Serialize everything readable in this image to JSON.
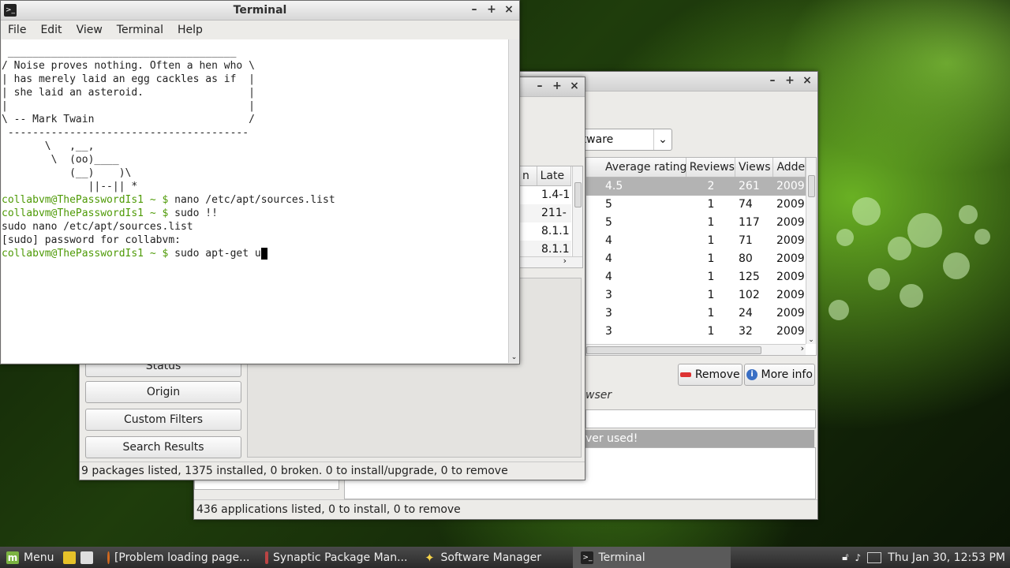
{
  "terminal": {
    "title": "Terminal",
    "menu": [
      "File",
      "Edit",
      "View",
      "Terminal",
      "Help"
    ],
    "lines": [
      {
        "text": " _____________________________________",
        "type": "plain"
      },
      {
        "text": "/ Noise proves nothing. Often a hen who \\",
        "type": "plain"
      },
      {
        "text": "| has merely laid an egg cackles as if  |",
        "type": "plain"
      },
      {
        "text": "| she laid an asteroid.                 |",
        "type": "plain"
      },
      {
        "text": "|                                       |",
        "type": "plain"
      },
      {
        "text": "\\ -- Mark Twain                         /",
        "type": "plain"
      },
      {
        "text": " ---------------------------------------",
        "type": "plain"
      },
      {
        "text": "       \\   ,__,",
        "type": "plain"
      },
      {
        "text": "        \\  (oo)____",
        "type": "plain"
      },
      {
        "text": "           (__)    )\\",
        "type": "plain"
      },
      {
        "text": "              ||--|| *",
        "type": "plain"
      },
      {
        "prompt": "collabvm@ThePasswordIs1 ~ $",
        "cmd": " nano /etc/apt/sources.list",
        "type": "prompt"
      },
      {
        "prompt": "collabvm@ThePasswordIs1 ~ $",
        "cmd": " sudo !!",
        "type": "prompt"
      },
      {
        "text": "sudo nano /etc/apt/sources.list",
        "type": "plain"
      },
      {
        "text": "[sudo] password for collabvm:",
        "type": "plain"
      },
      {
        "prompt": "collabvm@ThePasswordIs1 ~ $",
        "cmd": " sudo apt-get u",
        "type": "prompt",
        "cursor": true
      }
    ]
  },
  "synaptic": {
    "columns": [
      "n",
      "Late"
    ],
    "versions": [
      "1.4-1",
      "211-",
      "8.1.1",
      "8.1.1"
    ],
    "side_buttons": [
      "Status",
      "Origin",
      "Custom Filters",
      "Search Results"
    ],
    "status": "9 packages listed, 1375 installed, 0 broken. 0 to install/upgrade, 0 to remove"
  },
  "software_manager": {
    "filter_value": "ftware",
    "columns": [
      "Average rating",
      "Reviews",
      "Views",
      "Adde"
    ],
    "rows": [
      {
        "rating": "4.5",
        "reviews": "2",
        "views": "261",
        "added": "2009-"
      },
      {
        "rating": "5",
        "reviews": "1",
        "views": "74",
        "added": "2009-"
      },
      {
        "rating": "5",
        "reviews": "1",
        "views": "117",
        "added": "2009-"
      },
      {
        "rating": "4",
        "reviews": "1",
        "views": "71",
        "added": "2009-"
      },
      {
        "rating": "4",
        "reviews": "1",
        "views": "80",
        "added": "2009-"
      },
      {
        "rating": "4",
        "reviews": "1",
        "views": "125",
        "added": "2009-"
      },
      {
        "rating": "3",
        "reviews": "1",
        "views": "102",
        "added": "2009-"
      },
      {
        "rating": "3",
        "reviews": "1",
        "views": "24",
        "added": "2009-"
      },
      {
        "rating": "3",
        "reviews": "1",
        "views": "32",
        "added": "2009-"
      }
    ],
    "remove_label": "Remove",
    "more_info_label": "More info",
    "browser_label": "wser",
    "never_used": "ver used!",
    "status": "436 applications listed, 0 to install, 0 to remove"
  },
  "taskbar": {
    "menu_label": "Menu",
    "tasks": [
      {
        "label": "[Problem loading page...",
        "icon": "firefox-icon"
      },
      {
        "label": "Synaptic Package Man...",
        "icon": "synaptic-icon"
      },
      {
        "label": "Software Manager",
        "icon": "star-icon"
      },
      {
        "label": "Terminal",
        "icon": "terminal-icon",
        "active": true
      }
    ],
    "clock": "Thu Jan 30, 12:53 PM"
  },
  "colors": {
    "prompt": "#4e9a06",
    "selected_row": "#b3b3b3"
  }
}
